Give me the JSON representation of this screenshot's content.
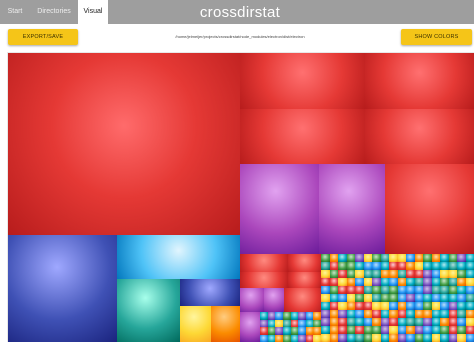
{
  "app": {
    "title": "crossdirstat"
  },
  "tabs": [
    {
      "label": "Start",
      "active": false
    },
    {
      "label": "Directories",
      "active": false
    },
    {
      "label": "Visual",
      "active": true
    }
  ],
  "toolbar": {
    "export_label": "EXPORT/SAVE",
    "path": "/home/jelmeijer/projects/crossdirstat/node_modules/electron/dist/electron",
    "show_colors_label": "SHOW COLORS"
  },
  "colors": {
    "topbar": "#9e9e9e",
    "button": "#f5c518",
    "red": "#e53935",
    "violet": "#ab47bc",
    "blue": "#3f51b5",
    "teal": "#26a69a",
    "cyan": "#4fc3f7",
    "yellow": "#fdd835"
  }
}
